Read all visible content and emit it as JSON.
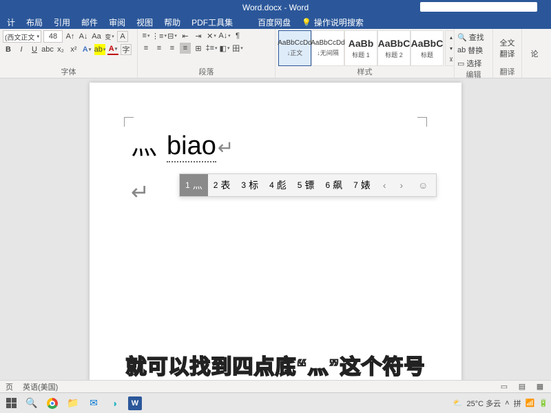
{
  "title": "Word.docx - Word",
  "menu": [
    "计",
    "布局",
    "引用",
    "邮件",
    "审阅",
    "视图",
    "帮助",
    "PDF工具集"
  ],
  "menu_extra": "百度网盘",
  "help_hint": "操作说明搜索",
  "font": {
    "name": "(西文正文",
    "size": "48"
  },
  "group_labels": {
    "font": "字体",
    "para": "段落",
    "styles": "样式",
    "edit": "编辑",
    "trans": "翻译",
    "save": "论"
  },
  "styles": [
    {
      "preview": "AaBbCcDd",
      "label": "↓正文",
      "selected": true
    },
    {
      "preview": "AaBbCcDd",
      "label": "↓无间隔",
      "selected": false
    },
    {
      "preview": "AaBb",
      "label": "标题 1",
      "selected": false,
      "big": true
    },
    {
      "preview": "AaBbC",
      "label": "标题 2",
      "selected": false,
      "big": true
    },
    {
      "preview": "AaBbC",
      "label": "标题",
      "selected": false,
      "big": true
    }
  ],
  "edit": {
    "find": "查找",
    "replace": "替换",
    "select": "选择"
  },
  "trans": {
    "full": "全文",
    "trans": "翻译"
  },
  "doc": {
    "char": "灬",
    "typed": "biao"
  },
  "ime": {
    "candidates": [
      {
        "n": "1",
        "t": "灬",
        "sel": true
      },
      {
        "n": "2",
        "t": "表"
      },
      {
        "n": "3",
        "t": "标"
      },
      {
        "n": "4",
        "t": "彪"
      },
      {
        "n": "5",
        "t": "镖"
      },
      {
        "n": "6",
        "t": "飙"
      },
      {
        "n": "7",
        "t": "婊"
      }
    ]
  },
  "caption": "就可以找到四点底“灬”这个符号",
  "status": {
    "page": "页",
    "lang": "英语(美国)"
  },
  "weather": "25°C 多云"
}
